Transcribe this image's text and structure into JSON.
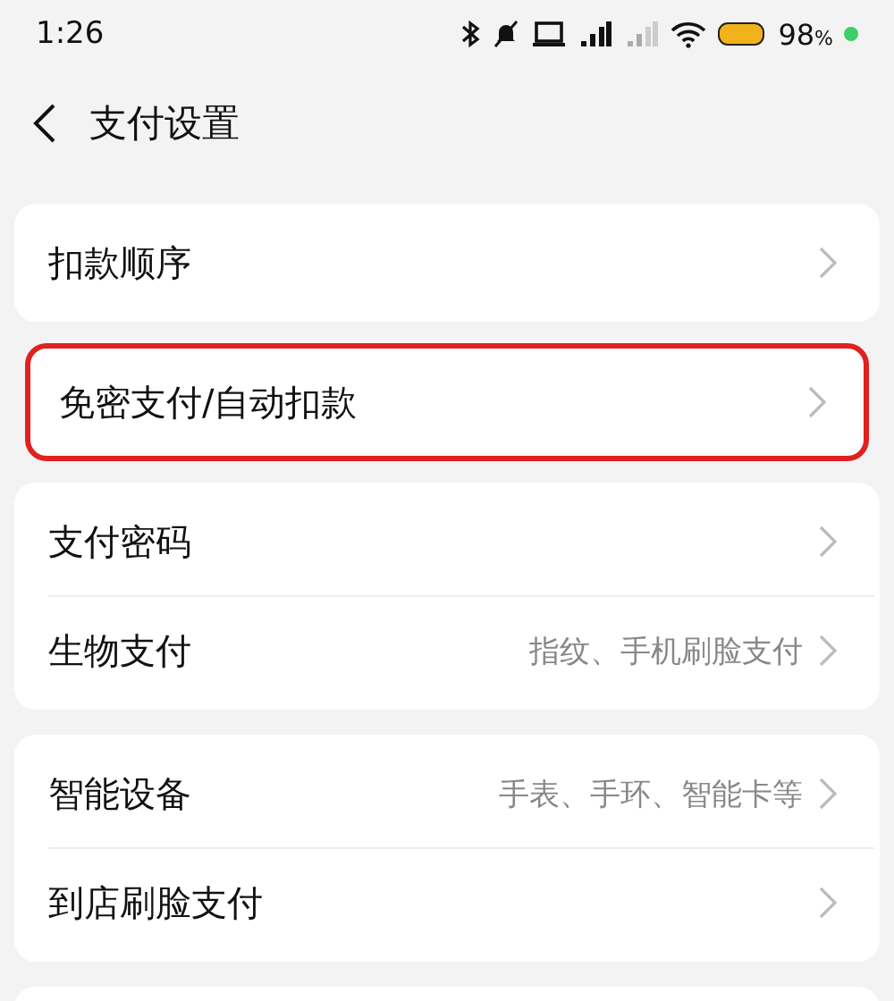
{
  "status_bar": {
    "time": "1:26",
    "battery": "98",
    "battery_unit": "%"
  },
  "header": {
    "title": "支付设置"
  },
  "groups": [
    {
      "highlighted": false,
      "rows": [
        {
          "label": "扣款顺序"
        }
      ]
    },
    {
      "highlighted": true,
      "rows": [
        {
          "label": "免密支付/自动扣款"
        }
      ]
    },
    {
      "highlighted": false,
      "rows": [
        {
          "label": "支付密码"
        },
        {
          "label": "生物支付",
          "detail": "指纹、手机刷脸支付"
        }
      ]
    },
    {
      "highlighted": false,
      "rows": [
        {
          "label": "智能设备",
          "detail": "手表、手环、智能卡等"
        },
        {
          "label": "到店刷脸支付"
        }
      ]
    }
  ]
}
